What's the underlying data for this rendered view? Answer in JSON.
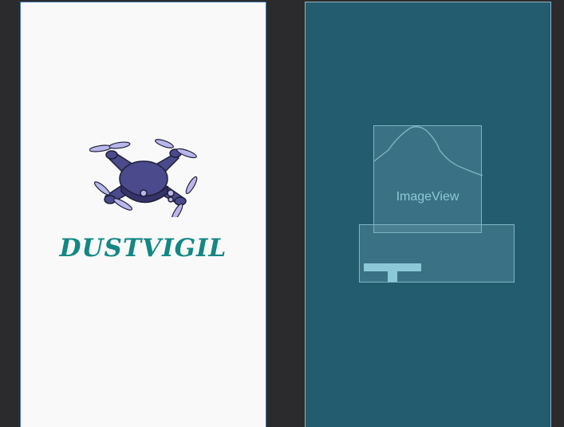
{
  "design": {
    "app_title": "DUSTVIGIL",
    "logo_icon": "drone-icon",
    "title_color": "#138784",
    "drone_color": "#4b4a8c",
    "propeller_color": "#b9b7ea"
  },
  "blueprint": {
    "image_view_label": "ImageView",
    "image_view_icon": "image-placeholder-icon",
    "text_view_icon": "text-placeholder-icon",
    "background_color": "#245c6f",
    "outline_color": "#7fb4c4"
  }
}
